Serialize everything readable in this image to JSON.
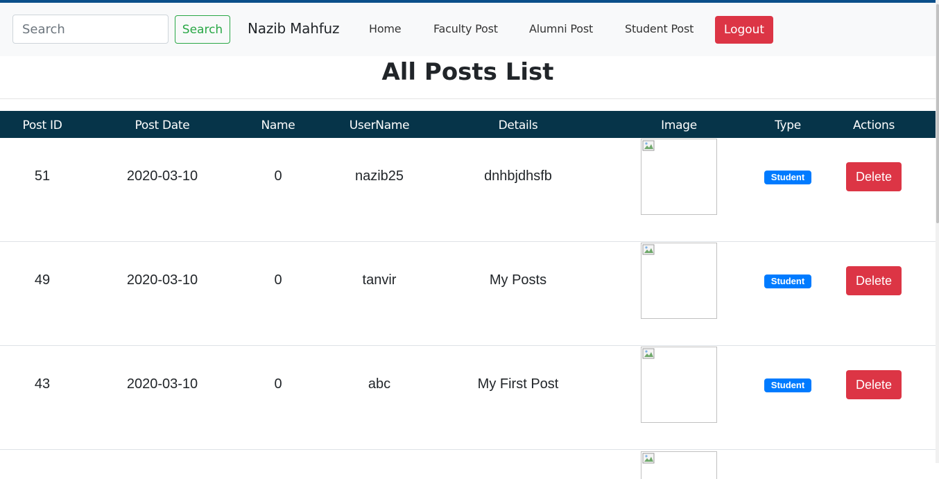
{
  "navbar": {
    "search_placeholder": "Search",
    "search_button": "Search",
    "brand": "Nazib Mahfuz",
    "links": [
      "Home",
      "Faculty Post",
      "Alumni Post",
      "Student Post"
    ],
    "logout": "Logout"
  },
  "page": {
    "title": "All Posts List"
  },
  "table": {
    "headers": [
      "Post ID",
      "Post Date",
      "Name",
      "UserName",
      "Details",
      "Image",
      "Type",
      "Actions"
    ],
    "rows": [
      {
        "post_id": "51",
        "post_date": "2020-03-10",
        "name": "0",
        "username": "nazib25",
        "details": "dnhbjdhsfb",
        "type": "Student",
        "action": "Delete"
      },
      {
        "post_id": "49",
        "post_date": "2020-03-10",
        "name": "0",
        "username": "tanvir",
        "details": "My Posts",
        "type": "Student",
        "action": "Delete"
      },
      {
        "post_id": "43",
        "post_date": "2020-03-10",
        "name": "0",
        "username": "abc",
        "details": "My First Post",
        "type": "Student",
        "action": "Delete"
      }
    ]
  },
  "colors": {
    "header_bg": "#063449",
    "danger": "#dc3545",
    "success": "#28a745",
    "primary": "#007bff"
  }
}
